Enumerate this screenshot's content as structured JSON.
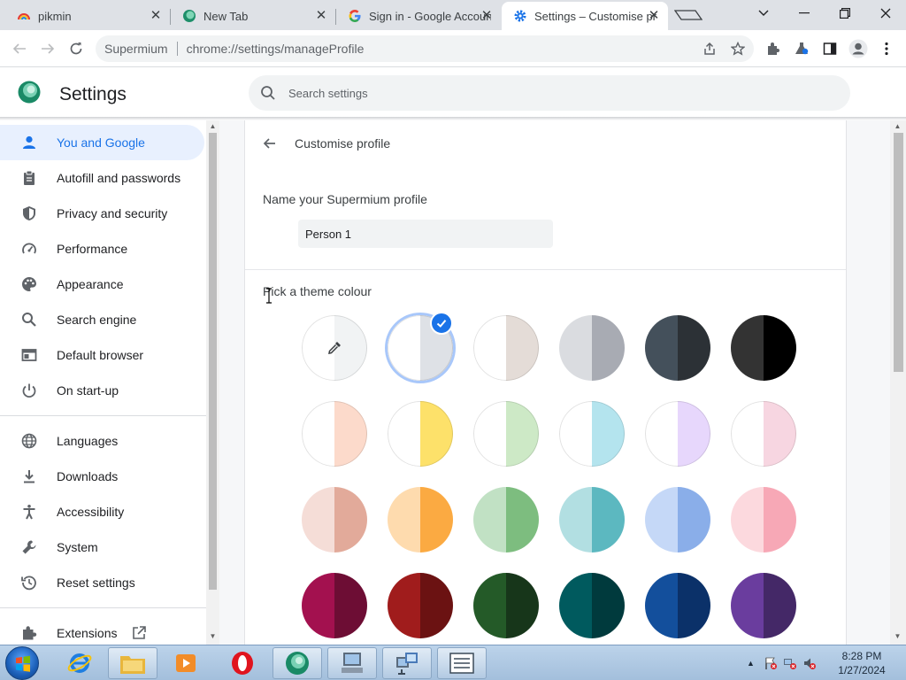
{
  "browser": {
    "tabs": [
      {
        "title": "pikmin",
        "favicon": "rainbow-favicon-icon"
      },
      {
        "title": "New Tab",
        "favicon": "supermium-favicon-icon"
      },
      {
        "title": "Sign in - Google Accounts",
        "favicon": "google-favicon-icon"
      },
      {
        "title": "Settings – Customise profile",
        "favicon": "gear-favicon-icon",
        "active": true
      }
    ],
    "omnibox": {
      "brand": "Supermium",
      "url": "chrome://settings/manageProfile"
    }
  },
  "settings": {
    "title": "Settings",
    "search_placeholder": "Search settings"
  },
  "sidebar": {
    "items": [
      {
        "label": "You and Google",
        "icon": "person-icon",
        "active": true
      },
      {
        "label": "Autofill and passwords",
        "icon": "clipboard-icon"
      },
      {
        "label": "Privacy and security",
        "icon": "shield-icon"
      },
      {
        "label": "Performance",
        "icon": "speedometer-icon"
      },
      {
        "label": "Appearance",
        "icon": "palette-icon"
      },
      {
        "label": "Search engine",
        "icon": "search-icon"
      },
      {
        "label": "Default browser",
        "icon": "browser-window-icon"
      },
      {
        "label": "On start-up",
        "icon": "power-icon"
      },
      {
        "label": "Languages",
        "icon": "globe-icon"
      },
      {
        "label": "Downloads",
        "icon": "download-icon"
      },
      {
        "label": "Accessibility",
        "icon": "accessibility-icon"
      },
      {
        "label": "System",
        "icon": "wrench-icon"
      },
      {
        "label": "Reset settings",
        "icon": "reset-icon"
      },
      {
        "label": "Extensions",
        "icon": "puzzle-icon"
      }
    ]
  },
  "profile": {
    "page_title": "Customise profile",
    "name_label": "Name your Supermium profile",
    "name_value": "Person 1",
    "theme_label": "Pick a theme colour",
    "theme_colors": [
      {
        "left": "#ffffff",
        "right": "#f1f3f4",
        "type": "custom-picker"
      },
      {
        "left": "#ffffff",
        "right": "#dee1e6",
        "selected": true
      },
      {
        "left": "#ffffff",
        "right": "#e4dcd7"
      },
      {
        "left": "#dadce0",
        "right": "#a8abb3"
      },
      {
        "left": "#44505b",
        "right": "#2c3136"
      },
      {
        "left": "#333333",
        "right": "#000000"
      },
      {
        "left": "#ffffff",
        "right": "#fcdacb"
      },
      {
        "left": "#ffffff",
        "right": "#fde16a"
      },
      {
        "left": "#ffffff",
        "right": "#cde9c6"
      },
      {
        "left": "#ffffff",
        "right": "#b4e4ee"
      },
      {
        "left": "#ffffff",
        "right": "#e7d7fc"
      },
      {
        "left": "#ffffff",
        "right": "#f7d6e1"
      },
      {
        "left": "#f5ddd7",
        "right": "#e2aa9a"
      },
      {
        "left": "#fedbae",
        "right": "#fbaa42"
      },
      {
        "left": "#c1e1c4",
        "right": "#7dbd7f"
      },
      {
        "left": "#b2dfe2",
        "right": "#5cb8c0"
      },
      {
        "left": "#c5d8f7",
        "right": "#8aaee9"
      },
      {
        "left": "#fcd9de",
        "right": "#f7a8b6"
      },
      {
        "left": "#a3114f",
        "right": "#6d0d34"
      },
      {
        "left": "#a01c1c",
        "right": "#6b1212"
      },
      {
        "left": "#245a28",
        "right": "#17361a"
      },
      {
        "left": "#005a5e",
        "right": "#003a3d"
      },
      {
        "left": "#134f9c",
        "right": "#0b3169"
      },
      {
        "left": "#6a3d9e",
        "right": "#442867"
      }
    ]
  },
  "taskbar": {
    "time": "8:28 PM",
    "date": "1/27/2024"
  },
  "colors": {
    "accent": "#1a73e8",
    "active_nav_bg": "#e8f0fe"
  }
}
